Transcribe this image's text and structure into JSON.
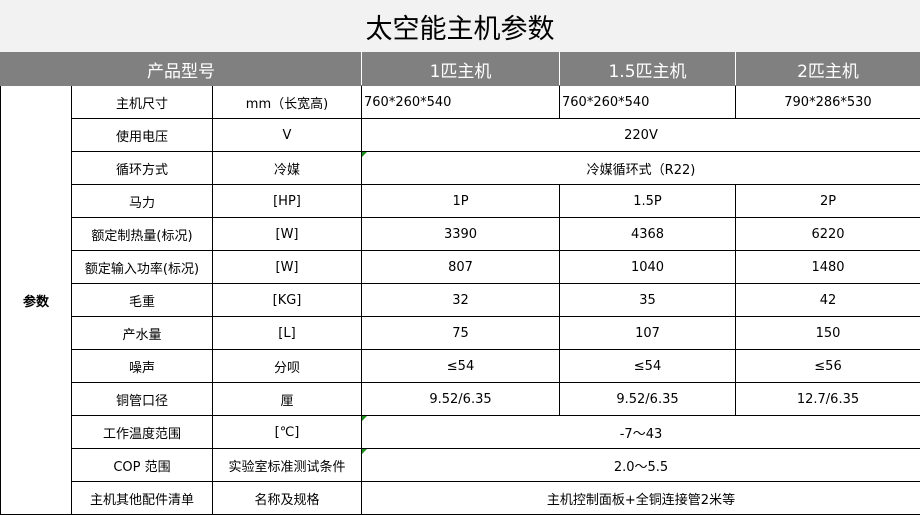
{
  "title": "太空能主机参数",
  "header": {
    "product_model": "产品型号",
    "col1": "1匹主机",
    "col2": "1.5匹主机",
    "col3": "2匹主机"
  },
  "side_label": "参数",
  "rows": {
    "size": {
      "name": "主机尺寸",
      "unit": "mm（长宽高)",
      "v1": "760*260*540",
      "v2": "760*260*540",
      "v3": "790*286*530"
    },
    "voltage": {
      "name": "使用电压",
      "unit": "V",
      "all": "220V"
    },
    "cycle": {
      "name": "循环方式",
      "unit": "冷媒",
      "all": "冷媒循环式（R22)"
    },
    "hp": {
      "name": "马力",
      "unit": "[HP]",
      "v1": "1P",
      "v2": "1.5P",
      "v3": "2P"
    },
    "heat": {
      "name": "额定制热量(标况)",
      "unit": "[W]",
      "v1": "3390",
      "v2": "4368",
      "v3": "6220"
    },
    "power": {
      "name": "额定输入功率(标况)",
      "unit": "[W]",
      "v1": "807",
      "v2": "1040",
      "v3": "1480"
    },
    "weight": {
      "name": "毛重",
      "unit": "[KG]",
      "v1": "32",
      "v2": "35",
      "v3": "42"
    },
    "water": {
      "name": "产水量",
      "unit": "[L]",
      "v1": "75",
      "v2": "107",
      "v3": "150"
    },
    "noise": {
      "name": "噪声",
      "unit": "分呗",
      "v1": "≤54",
      "v2": "≤54",
      "v3": "≤56"
    },
    "pipe": {
      "name": "铜管口径",
      "unit": "厘",
      "v1": "9.52/6.35",
      "v2": "9.52/6.35",
      "v3": "12.7/6.35"
    },
    "temp": {
      "name": "工作温度范围",
      "unit": "[℃]",
      "all": "-7～43"
    },
    "cop": {
      "name": "COP 范围",
      "unit": "实验室标准测试条件",
      "all": "2.0～5.5"
    },
    "parts": {
      "name": "主机其他配件清单",
      "unit": "名称及规格",
      "all": "主机控制面板+全铜连接管2米等"
    }
  }
}
